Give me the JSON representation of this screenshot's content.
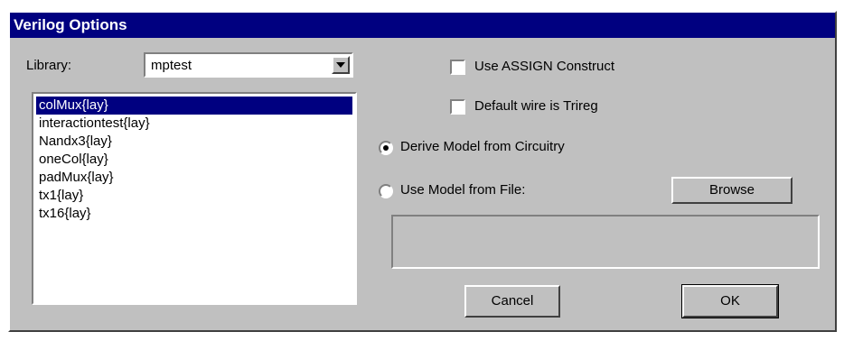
{
  "dialog": {
    "title": "Verilog Options"
  },
  "library": {
    "label": "Library:",
    "selected": "mptest"
  },
  "cells": {
    "items": [
      {
        "label": "colMux{lay}",
        "selected": true
      },
      {
        "label": "interactiontest{lay}",
        "selected": false
      },
      {
        "label": "Nandx3{lay}",
        "selected": false
      },
      {
        "label": "oneCol{lay}",
        "selected": false
      },
      {
        "label": "padMux{lay}",
        "selected": false
      },
      {
        "label": "tx1{lay}",
        "selected": false
      },
      {
        "label": "tx16{lay}",
        "selected": false
      }
    ]
  },
  "options": {
    "use_assign": {
      "label": "Use ASSIGN Construct",
      "checked": false
    },
    "default_trireg": {
      "label": "Default wire is Trireg",
      "checked": false
    }
  },
  "model": {
    "derive": {
      "label": "Derive Model from Circuitry",
      "selected": true
    },
    "from_file": {
      "label": "Use Model from File:",
      "selected": false
    },
    "browse_label": "Browse",
    "file_path": ""
  },
  "buttons": {
    "cancel": "Cancel",
    "ok": "OK"
  },
  "colors": {
    "title_bar": "#000080",
    "face": "#c0c0c0",
    "selection": "#000080"
  }
}
